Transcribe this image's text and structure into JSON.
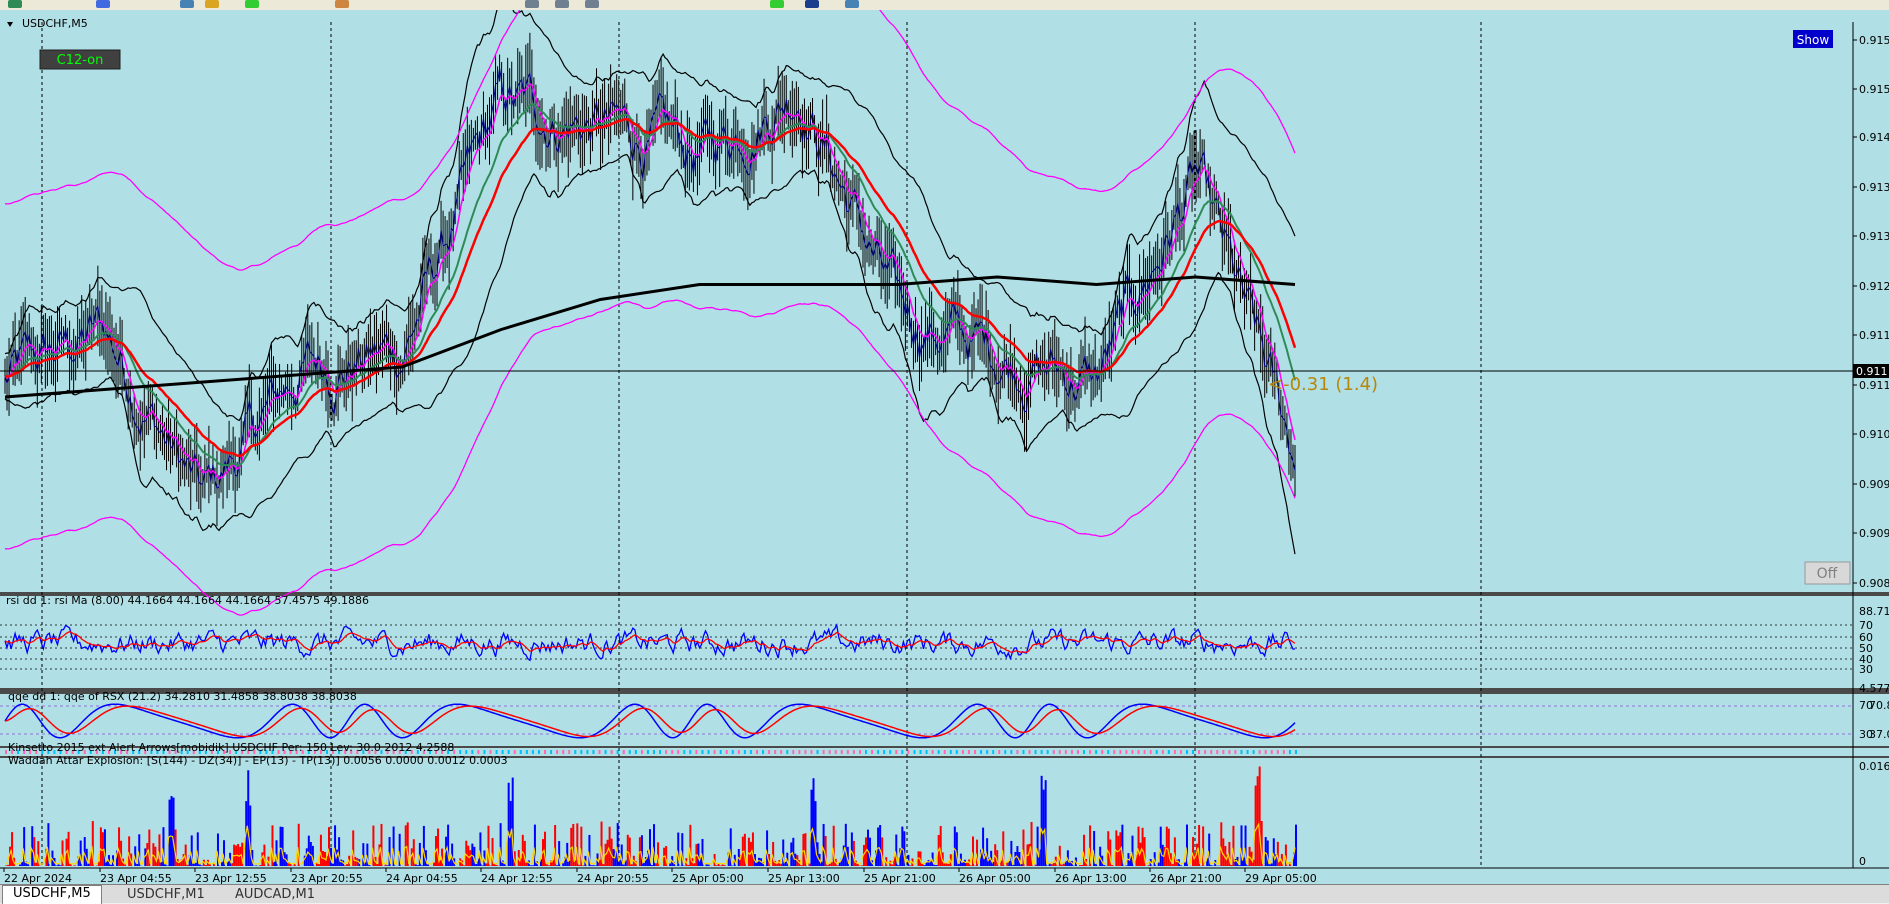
{
  "symbol_title": "USDCHF,M5",
  "c12_button": "C12-on",
  "show_button": "Show",
  "off_button": "Off",
  "price_annotation": "<-0.31 (1.4)",
  "current_price_label": "0.911",
  "main_price_ticks": [
    "0.915",
    "0.915",
    "0.914",
    "0.913",
    "0.913",
    "0.912",
    "0.911",
    "0.911",
    "0.910",
    "0.909",
    "0.909",
    "0.908"
  ],
  "time_labels": [
    "22 Apr 2024",
    "23 Apr 04:55",
    "23 Apr 12:55",
    "23 Apr 20:55",
    "24 Apr 04:55",
    "24 Apr 12:55",
    "24 Apr 20:55",
    "25 Apr 05:00",
    "25 Apr 13:00",
    "25 Apr 21:00",
    "26 Apr 05:00",
    "26 Apr 13:00",
    "26 Apr 21:00",
    "29 Apr 05:00"
  ],
  "rsi_panel": {
    "title": "rsi dd 1: rsi Ma (8.00) 44.1664 44.1664 44.1664 57.4575 49.1886",
    "ticks": [
      "88.71",
      "70",
      "60",
      "50",
      "40",
      "30",
      "4.577"
    ]
  },
  "qqe_panel": {
    "title": "qqe dd 1: qqe of RSX (21.2) 34.2810 31.4858 38.8038 38.8038",
    "ticks": [
      "70.84",
      "70",
      "30",
      "37.08"
    ]
  },
  "kinsetto_panel": {
    "title": "Kinsetto 2015 ext Alert Arrows[mobidik] USDCHF Per: 150 Lev: 30.0 2012 4.2588"
  },
  "waddah_panel": {
    "title": "Waddah Attar Explosion: [S(144) - DZ(34)] - EP(13) - TP(13)] 0.0056 0.0000 0.0012 0.0003",
    "ticks": [
      "0.016",
      "0"
    ]
  },
  "tabs": [
    "USDCHF,M5",
    "USDCHF,M1",
    "AUDCAD,M1"
  ],
  "colors": {
    "background": "#b0e0e6",
    "price_line": "#000080",
    "candle": "#000000",
    "ema_fast": "#ff00ff",
    "ema_red": "#ff0000",
    "ema_green": "#2e8b57",
    "bollinger": "#000000",
    "envelope": "#ff00ff",
    "rsi_line": "#0000ff",
    "rsi_ma": "#ff0000",
    "hist_blue": "#0000ff",
    "hist_red": "#ff0000",
    "hist_line": "#ffd700"
  },
  "chart_data": [
    {
      "type": "line",
      "title": "USDCHF,M5",
      "x": [
        "22 Apr 2024",
        "23 Apr 04:55",
        "23 Apr 12:55",
        "23 Apr 20:55",
        "24 Apr 04:55",
        "24 Apr 12:55",
        "24 Apr 20:55",
        "25 Apr 05:00",
        "25 Apr 13:00",
        "25 Apr 21:00",
        "26 Apr 05:00",
        "26 Apr 13:00",
        "26 Apr 21:00",
        "29 Apr 05:00"
      ],
      "series": [
        {
          "values": [
            0.9108,
            0.9115,
            0.9092,
            0.911,
            0.9112,
            0.9145,
            0.9142,
            0.9138,
            0.9148,
            0.9117,
            0.9112,
            0.9108,
            0.9135,
            0.9098
          ]
        },
        {
          "values": [
            0.9106,
            0.9107,
            0.9108,
            0.9109,
            0.911,
            0.9115,
            0.9119,
            0.9121,
            0.9121,
            0.9121,
            0.9122,
            0.9121,
            0.9122,
            0.9121
          ]
        }
      ],
      "ylim": [
        0.908,
        0.9156
      ]
    },
    {
      "type": "line",
      "title": "rsi dd 1: rsi Ma (8.00)",
      "ylim": [
        4.577,
        88.71
      ]
    },
    {
      "type": "line",
      "title": "qqe dd 1: qqe of RSX (21.2)",
      "ylim": [
        37.08,
        70.84
      ]
    },
    {
      "type": "bar",
      "title": "Waddah Attar Explosion",
      "ylim": [
        0,
        0.016
      ]
    }
  ]
}
